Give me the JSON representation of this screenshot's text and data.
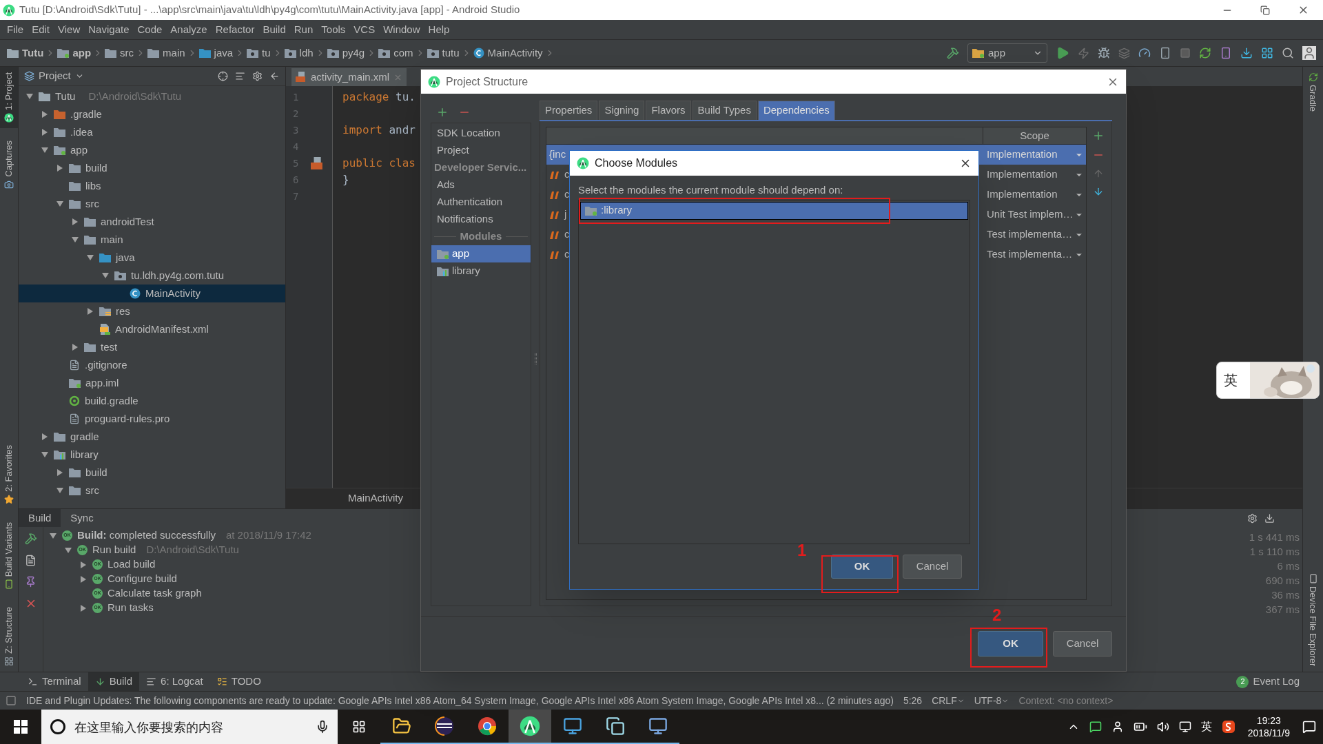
{
  "window": {
    "title": "Tutu [D:\\Android\\Sdk\\Tutu] - ...\\app\\src\\main\\java\\tu\\ldh\\py4g\\com\\tutu\\MainActivity.java [app] - Android Studio"
  },
  "menu": [
    "File",
    "Edit",
    "View",
    "Navigate",
    "Code",
    "Analyze",
    "Refactor",
    "Build",
    "Run",
    "Tools",
    "VCS",
    "Window",
    "Help"
  ],
  "breadcrumbs": [
    {
      "label": "Tutu",
      "kind": "project"
    },
    {
      "label": "app",
      "kind": "module"
    },
    {
      "label": "src",
      "kind": "folder"
    },
    {
      "label": "main",
      "kind": "folder"
    },
    {
      "label": "java",
      "kind": "source-folder"
    },
    {
      "label": "tu",
      "kind": "package"
    },
    {
      "label": "ldh",
      "kind": "package"
    },
    {
      "label": "py4g",
      "kind": "package"
    },
    {
      "label": "com",
      "kind": "package"
    },
    {
      "label": "tutu",
      "kind": "package"
    },
    {
      "label": "MainActivity",
      "kind": "class"
    }
  ],
  "run_config": "app",
  "left_tool_tabs": [
    {
      "label": "1: Project",
      "kind": "project",
      "selected": true
    },
    {
      "label": "Captures",
      "kind": "captures",
      "selected": false
    },
    {
      "label": "2: Favorites",
      "kind": "favorites",
      "selected": false
    },
    {
      "label": "Build Variants",
      "kind": "variants",
      "selected": false
    },
    {
      "label": "Z: Structure",
      "kind": "structure",
      "selected": false
    }
  ],
  "right_tool_tabs": [
    {
      "label": "Gradle",
      "kind": "gradle"
    },
    {
      "label": "Device File Explorer",
      "kind": "device"
    }
  ],
  "project": {
    "view": "Project",
    "tree": [
      {
        "label": "Tutu",
        "path": "D:\\Android\\Sdk\\Tutu",
        "kind": "project",
        "expanded": true,
        "selected": false,
        "children": [
          {
            "label": ".gradle",
            "kind": "excluded-folder",
            "expanded": false,
            "selected": false
          },
          {
            "label": ".idea",
            "kind": "folder",
            "expanded": false,
            "selected": false
          },
          {
            "label": "app",
            "kind": "module",
            "expanded": true,
            "selected": false,
            "children": [
              {
                "label": "build",
                "kind": "folder",
                "expanded": false,
                "selected": false
              },
              {
                "label": "libs",
                "kind": "folder",
                "selected": false
              },
              {
                "label": "src",
                "kind": "folder",
                "expanded": true,
                "selected": false,
                "children": [
                  {
                    "label": "androidTest",
                    "kind": "folder",
                    "expanded": false,
                    "selected": false
                  },
                  {
                    "label": "main",
                    "kind": "folder",
                    "expanded": true,
                    "selected": false,
                    "children": [
                      {
                        "label": "java",
                        "kind": "source-folder",
                        "expanded": true,
                        "selected": false,
                        "children": [
                          {
                            "label": "tu.ldh.py4g.com.tutu",
                            "kind": "package",
                            "expanded": true,
                            "selected": false,
                            "children": [
                              {
                                "label": "MainActivity",
                                "kind": "class",
                                "selected": true
                              }
                            ]
                          }
                        ]
                      },
                      {
                        "label": "res",
                        "kind": "res-folder",
                        "expanded": false,
                        "selected": false
                      },
                      {
                        "label": "AndroidManifest.xml",
                        "kind": "manifest",
                        "selected": false
                      }
                    ]
                  },
                  {
                    "label": "test",
                    "kind": "folder",
                    "expanded": false,
                    "selected": false
                  }
                ]
              },
              {
                "label": ".gitignore",
                "kind": "file",
                "selected": false
              },
              {
                "label": "app.iml",
                "kind": "module",
                "selected": false
              },
              {
                "label": "build.gradle",
                "kind": "gradle",
                "selected": false
              },
              {
                "label": "proguard-rules.pro",
                "kind": "file",
                "selected": false
              }
            ]
          },
          {
            "label": "gradle",
            "kind": "folder",
            "expanded": false,
            "selected": false
          },
          {
            "label": "library",
            "kind": "library-module",
            "expanded": true,
            "selected": false,
            "children": [
              {
                "label": "build",
                "kind": "folder",
                "expanded": false,
                "selected": false
              },
              {
                "label": "src",
                "kind": "folder",
                "expanded": true,
                "selected": false
              }
            ]
          }
        ]
      }
    ]
  },
  "editor": {
    "tab": "activity_main.xml",
    "lines": [
      {
        "number": "1",
        "keyword": "package",
        "rest": " tu.",
        "marker": false
      },
      {
        "number": "2",
        "marker": false
      },
      {
        "number": "3",
        "keyword": "import",
        "rest": " andr",
        "marker": false
      },
      {
        "number": "4",
        "marker": false
      },
      {
        "number": "5",
        "keyword": "public clas",
        "marker": true
      },
      {
        "number": "6",
        "rest": "}",
        "marker": false
      },
      {
        "number": "7",
        "marker": false
      }
    ],
    "breadcrumb": "MainActivity"
  },
  "build_panel": {
    "tabs": [
      {
        "label": "Build",
        "selected": true
      },
      {
        "label": "Sync",
        "selected": false
      }
    ],
    "tree": [
      {
        "label": "**Build:** completed successfully",
        "status": "OK",
        "detail": "at 2018/11/9 17:42",
        "expanded": true,
        "children": [
          {
            "label": "Run build",
            "status": "OK",
            "detail": "D:\\Android\\Sdk\\Tutu",
            "expanded": true,
            "children": [
              {
                "label": "Load build",
                "status": "OK",
                "expanded": false
              },
              {
                "label": "Configure build",
                "status": "OK",
                "expanded": false
              },
              {
                "label": "Calculate task graph",
                "status": "OK"
              },
              {
                "label": "Run tasks",
                "status": "OK",
                "expanded": false
              }
            ]
          }
        ]
      }
    ],
    "times": [
      "1 s 441 ms",
      "1 s 110 ms",
      "6 ms",
      "690 ms",
      "36 ms",
      "367 ms"
    ]
  },
  "project_structure": {
    "title": "Project Structure",
    "sidebar": [
      {
        "label": "SDK Location",
        "kind": "item",
        "selected": false
      },
      {
        "label": "Project",
        "kind": "item",
        "selected": false
      },
      {
        "label": "Developer Servic...",
        "kind": "header"
      },
      {
        "label": "Ads",
        "kind": "item",
        "selected": false
      },
      {
        "label": "Authentication",
        "kind": "item",
        "selected": false
      },
      {
        "label": "Notifications",
        "kind": "item",
        "selected": false
      },
      {
        "label": "Modules",
        "kind": "section"
      },
      {
        "label": "app",
        "kind": "module",
        "selected": true
      },
      {
        "label": "library",
        "kind": "library-module",
        "selected": false
      }
    ],
    "tabs": [
      {
        "label": "Properties",
        "selected": false
      },
      {
        "label": "Signing",
        "selected": false
      },
      {
        "label": "Flavors",
        "selected": false
      },
      {
        "label": "Build Types",
        "selected": false
      },
      {
        "label": "Dependencies",
        "selected": true
      }
    ],
    "dependencies": {
      "columns": [
        "Scope"
      ],
      "rows": [
        {
          "name": "{inc",
          "kind": "jar",
          "scope": "Implementation",
          "selected": true
        },
        {
          "name": "c",
          "kind": "maven",
          "scope": "Implementation",
          "selected": false
        },
        {
          "name": "c",
          "kind": "maven",
          "scope": "Implementation",
          "selected": false
        },
        {
          "name": "j",
          "kind": "maven",
          "scope": "Unit Test implem…",
          "selected": false
        },
        {
          "name": "c",
          "kind": "maven",
          "scope": "Test implementa…",
          "selected": false
        },
        {
          "name": "c",
          "kind": "maven",
          "scope": "Test implementa…",
          "selected": false
        }
      ]
    },
    "buttons": [
      "OK",
      "Cancel"
    ],
    "ok_annotation": "2"
  },
  "choose_modules": {
    "title": "Choose Modules",
    "prompt": "Select the modules the current module should depend on:",
    "modules": [
      {
        "label": ":library",
        "selected": true,
        "outlined": true
      }
    ],
    "buttons": [
      "OK",
      "Cancel"
    ],
    "ok_annotation": "1"
  },
  "bottom_tabs": [
    {
      "label": "Terminal",
      "kind": "terminal",
      "selected": false
    },
    {
      "label": "Build",
      "kind": "build",
      "selected": true
    },
    {
      "label": "6: Logcat",
      "kind": "logcat",
      "selected": false
    },
    {
      "label": "TODO",
      "kind": "todo",
      "selected": false
    }
  ],
  "event_log": {
    "label": "Event Log",
    "count": "2"
  },
  "status_bar": {
    "message": "IDE and Plugin Updates: The following components are ready to update: Google APIs Intel x86 Atom_64 System Image, Google APIs Intel x86 Atom System Image, Google APIs Intel x8... (2 minutes ago)",
    "position": "5:26",
    "line_separator": "CRLF",
    "encoding": "UTF-8",
    "context": "Context: <no context>"
  },
  "ime_widget": {
    "label": "英"
  },
  "taskbar": {
    "search_placeholder": "在这里输入你要搜索的内容",
    "apps": [
      {
        "kind": "files",
        "selected": false
      },
      {
        "kind": "eclipse",
        "selected": false
      },
      {
        "kind": "browser",
        "selected": false
      },
      {
        "kind": "studio",
        "selected": true
      },
      {
        "kind": "contacts",
        "selected": false
      },
      {
        "kind": "notes",
        "selected": false
      },
      {
        "kind": "computer",
        "selected": false
      }
    ],
    "ime": "英",
    "time": "19:23",
    "date": "2018/11/9"
  }
}
